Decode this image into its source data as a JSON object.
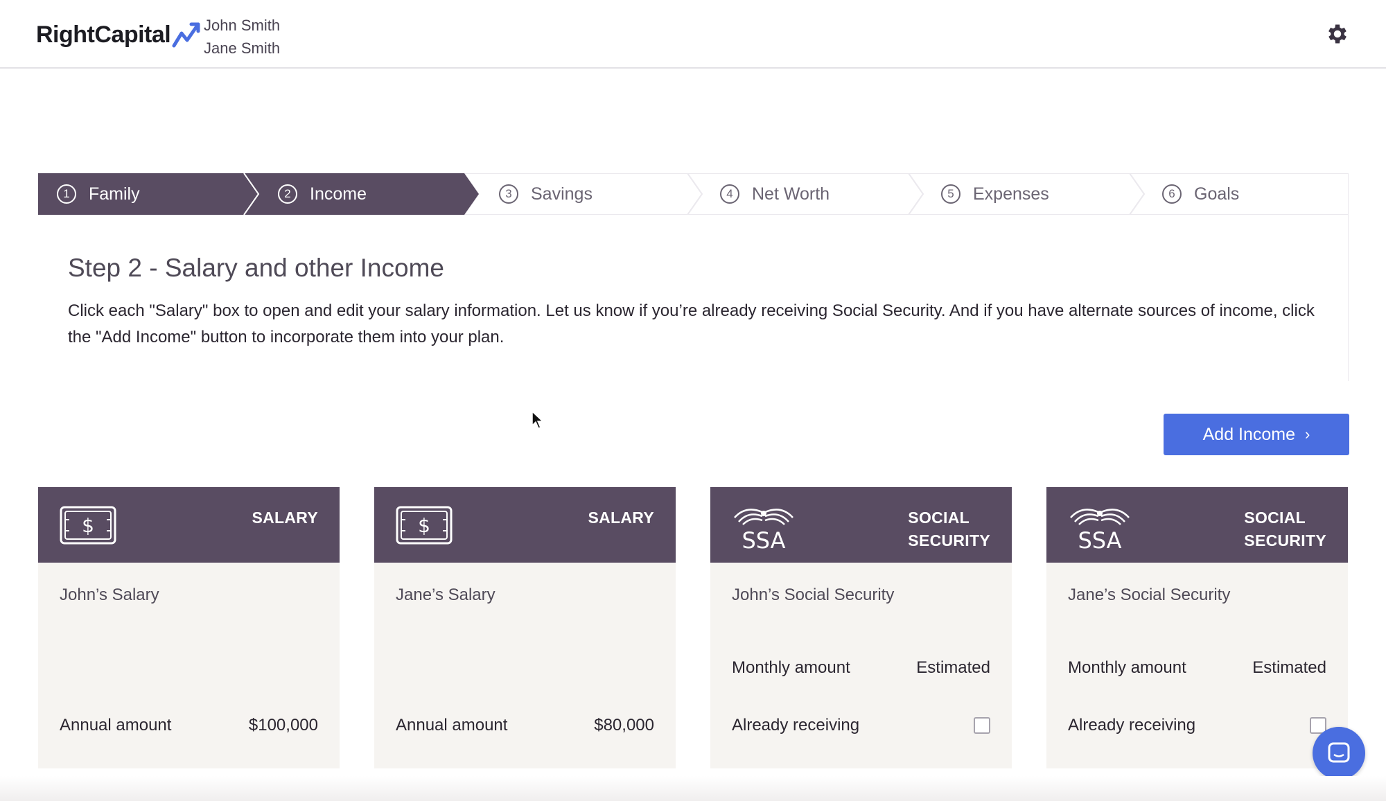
{
  "header": {
    "logo_text": "RightCapital",
    "clients": [
      "John Smith",
      "Jane Smith"
    ],
    "settings_icon": "gear-icon"
  },
  "stepper": [
    {
      "num": "1",
      "label": "Family",
      "state": "done"
    },
    {
      "num": "2",
      "label": "Income",
      "state": "done"
    },
    {
      "num": "3",
      "label": "Savings",
      "state": "todo"
    },
    {
      "num": "4",
      "label": "Net Worth",
      "state": "todo"
    },
    {
      "num": "5",
      "label": "Expenses",
      "state": "todo"
    },
    {
      "num": "6",
      "label": "Goals",
      "state": "todo"
    }
  ],
  "main": {
    "title": "Step 2 - Salary and other Income",
    "description": "Click each \"Salary\" box to open and edit your salary information. Let us know if you’re already receiving Social Security. And if you have alternate sources of income, click the \"Add Income\" button to incorporate them into your plan.",
    "add_income_label": "Add Income",
    "add_income_chevron": "›"
  },
  "cards": [
    {
      "type": "SALARY",
      "icon": "cash-icon",
      "name": "John’s Salary",
      "row1_label": "",
      "row1_value": "",
      "row2_label": "Annual amount",
      "row2_value": "$100,000"
    },
    {
      "type": "SALARY",
      "icon": "cash-icon",
      "name": "Jane’s Salary",
      "row1_label": "",
      "row1_value": "",
      "row2_label": "Annual amount",
      "row2_value": "$80,000"
    },
    {
      "type_line1": "SOCIAL",
      "type_line2": "SECURITY",
      "icon": "ssa-eagle-icon",
      "icon_text": "SSA",
      "name": "John’s Social Security",
      "row1_label": "Monthly amount",
      "row1_value": "Estimated",
      "row2_label": "Already receiving",
      "checked": false
    },
    {
      "type_line1": "SOCIAL",
      "type_line2": "SECURITY",
      "icon": "ssa-eagle-icon",
      "icon_text": "SSA",
      "name": "Jane’s Social Security",
      "row1_label": "Monthly amount",
      "row1_value": "Estimated",
      "row2_label": "Already receiving",
      "checked": false
    }
  ],
  "colors": {
    "brand_purple": "#594c62",
    "accent_blue": "#4a6ee0",
    "card_bg": "#f6f4f1"
  }
}
